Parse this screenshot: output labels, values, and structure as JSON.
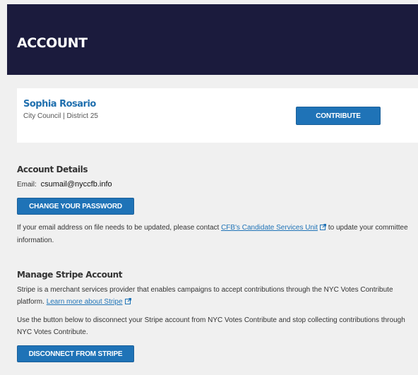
{
  "header": {
    "title": "ACCOUNT"
  },
  "candidate": {
    "name": "Sophia Rosario",
    "office": "City Council | District 25",
    "contribute_label": "CONTRIBUTE"
  },
  "account_details": {
    "heading": "Account Details",
    "email_label": "Email:",
    "email_value": "csumail@nyccfb.info",
    "change_password_label": "CHANGE YOUR PASSWORD",
    "info_text_before": "If your email address on file needs to be updated, please contact ",
    "info_link": "CFB's Candidate Services Unit",
    "info_text_after": " to update your committee information."
  },
  "stripe": {
    "heading": "Manage Stripe Account",
    "description": "Stripe is a merchant services provider that enables campaigns to accept contributions through the NYC Votes Contribute platform. ",
    "learn_more_link": "Learn more about Stripe",
    "disconnect_text": "Use the button below to disconnect your Stripe account from NYC Votes Contribute and stop collecting contributions through NYC Votes Contribute.",
    "disconnect_label": "DISCONNECT FROM STRIPE"
  },
  "colors": {
    "header_bg": "#1b1b3d",
    "accent": "#1f73b7",
    "page_bg": "#f0f0f0"
  },
  "icons": [
    "external-link-icon"
  ]
}
